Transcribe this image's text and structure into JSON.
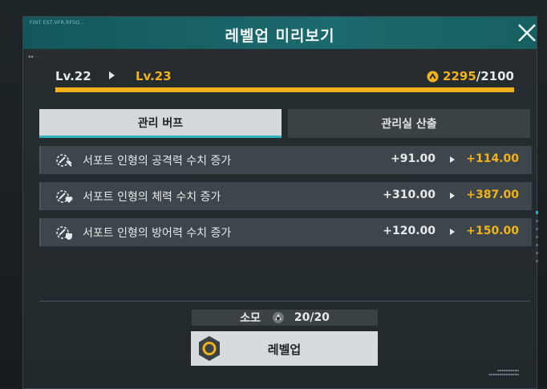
{
  "dialog": {
    "small_caption": "FINT EST.VFR.RFSO...",
    "title": "레벨업 미리보기"
  },
  "level": {
    "current": "Lv.22",
    "next": "Lv.23",
    "exp_have": "2295",
    "exp_need": "/2100",
    "progress": 1.0
  },
  "tabs": [
    {
      "label": "관리 버프",
      "active": true
    },
    {
      "label": "관리실 산출",
      "active": false
    }
  ],
  "stats": [
    {
      "icon": "support-attack-icon",
      "label": "서포트 인형의 공격력 수치 증가",
      "from": "+91.00",
      "to": "+114.00"
    },
    {
      "icon": "support-hp-icon",
      "label": "서포트 인형의 체력 수치 증가",
      "from": "+310.00",
      "to": "+387.00"
    },
    {
      "icon": "support-defense-icon",
      "label": "서포트 인형의 방어력 수치 증가",
      "from": "+120.00",
      "to": "+150.00"
    }
  ],
  "cost": {
    "label": "소모",
    "item_icon": "upgrade-material-icon",
    "amount": "20/20"
  },
  "levelup_button": {
    "label": "레벨업"
  },
  "colors": {
    "accent": "#f2b21c",
    "title_bar": "#1b6a6d",
    "tab_underline": "#2fb3c0"
  }
}
